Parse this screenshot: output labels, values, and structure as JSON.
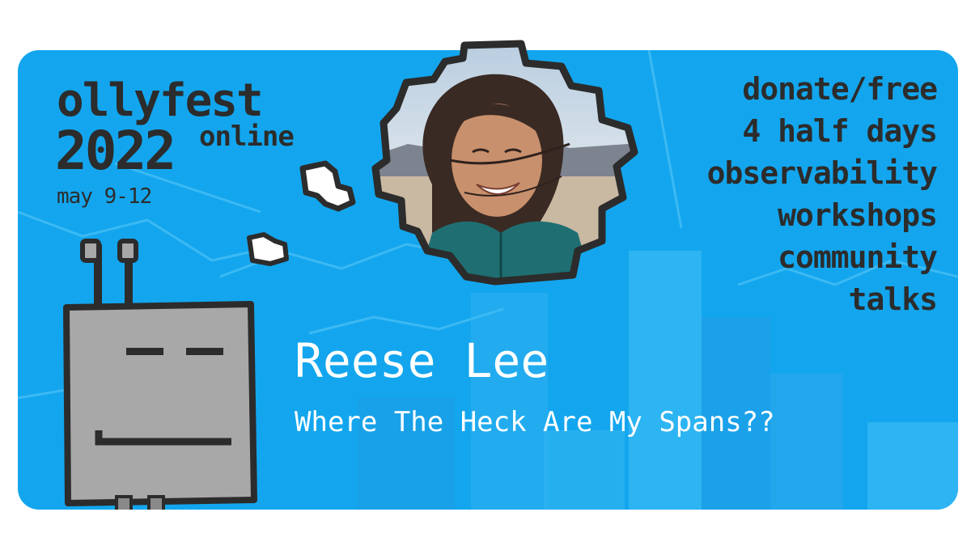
{
  "event": {
    "name": "ollyfest",
    "year": "2022",
    "format": "online",
    "dates": "may 9-12"
  },
  "features": [
    "donate/free",
    "4 half days",
    "observability",
    "workshops",
    "community",
    "talks"
  ],
  "speaker": {
    "name": "Reese Lee",
    "talk_title": "Where The Heck Are My Spans??"
  },
  "colors": {
    "background": "#13a6ee",
    "ink": "#2c2c2c",
    "robot_body": "#a8a8a8",
    "text_light": "#ffffff"
  }
}
